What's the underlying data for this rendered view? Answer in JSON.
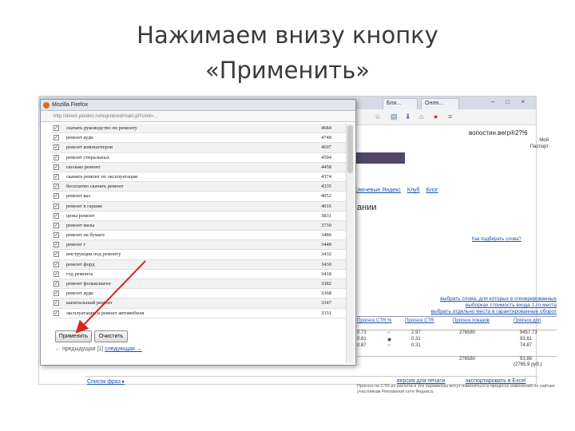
{
  "slide": {
    "title_line1": "Нажимаем внизу кнопку",
    "title_line2": "«Применить»"
  },
  "background_window": {
    "tab1": "Бли...",
    "tab2": "Онлн...",
    "window_controls": "– □ ×",
    "user": "вопостин.вегр®2?!6",
    "user_links": [
      "Мой",
      "Паспорт"
    ],
    "links": [
      "Ключевые Яндекс",
      "Клуб",
      "Блог"
    ],
    "heading_fragment": "ании",
    "help_link": "Как подбирать слова?",
    "select_links": [
      "выбрать слова, для которых в сгенерированных",
      "выборках стоимость входа 1-го места",
      "выбрать отдельно места в гарантированные оборот"
    ],
    "table_header": [
      "Прогноз CTR %",
      "Прогноз CTR",
      "Прогноз показов",
      "Прогноз доп"
    ],
    "table_rows": [
      [
        "0.73",
        "2.97",
        "276580",
        "9457.73"
      ],
      [
        "0.81",
        "0.31",
        "",
        "93.81"
      ],
      [
        "0.87",
        "0.31",
        "",
        "74.87"
      ]
    ],
    "table_total": [
      "276580",
      "93.88"
    ],
    "table_total_note": "(2765.9 руб.)",
    "note": "Прогноз по CTR из расчета и эти параметры могут изменяться в процессе изменений по сайтам-участникам Рекламной сети Яндекса.",
    "footer_links": [
      "Список фраз ▸",
      "версия для печати",
      "экспортировать в Excel"
    ]
  },
  "dialog": {
    "title": "Mozilla Firefox",
    "url": "http://direct.yandex.ru/registered/main.pl?cmd=...",
    "keywords": [
      {
        "phrase": "скачать руководство по ремонту",
        "count": "4684",
        "checked": true
      },
      {
        "phrase": "ремонт ауди",
        "count": "4748",
        "checked": true
      },
      {
        "phrase": "ремонт компьютеров",
        "count": "4697",
        "checked": true
      },
      {
        "phrase": "ремонт стиральных",
        "count": "4594",
        "checked": true
      },
      {
        "phrase": "сколько ремонт",
        "count": "4458",
        "checked": true
      },
      {
        "phrase": "скачать ремонт по эксплуатации",
        "count": "4374",
        "checked": true
      },
      {
        "phrase": "бесплатно скачать ремонт",
        "count": "4335",
        "checked": true
      },
      {
        "phrase": "ремонт ваз",
        "count": "4052",
        "checked": true
      },
      {
        "phrase": "ремонт в гараже",
        "count": "4016",
        "checked": true
      },
      {
        "phrase": "цены ремонт",
        "count": "3831",
        "checked": true
      },
      {
        "phrase": "ремонт мазы",
        "count": "3730",
        "checked": true
      },
      {
        "phrase": "ремонт на бумаге",
        "count": "3486",
        "checked": true
      },
      {
        "phrase": "ремонт г",
        "count": "3448",
        "checked": true
      },
      {
        "phrase": "инструкция под ремонту",
        "count": "3432",
        "checked": true
      },
      {
        "phrase": "ремонт форд",
        "count": "3430",
        "checked": true
      },
      {
        "phrase": "год ремонта",
        "count": "3418",
        "checked": true
      },
      {
        "phrase": "ремонт фольксваген",
        "count": "3382",
        "checked": true
      },
      {
        "phrase": "ремонт ауди",
        "count": "3368",
        "checked": true
      },
      {
        "phrase": "капитальный ремонт",
        "count": "3347",
        "checked": true
      },
      {
        "phrase": "эксплуатация и ремонт автомобиля",
        "count": "3331",
        "checked": true
      }
    ],
    "apply_button": "Применить",
    "reset_button": "Очистить",
    "pager_prev": "← предыдущая",
    "pager_current": "[1]",
    "pager_next": "следующая →"
  },
  "colors": {
    "arrow": "#d9261c",
    "nav_bar": "#514568",
    "link": "#1a4fb3"
  }
}
